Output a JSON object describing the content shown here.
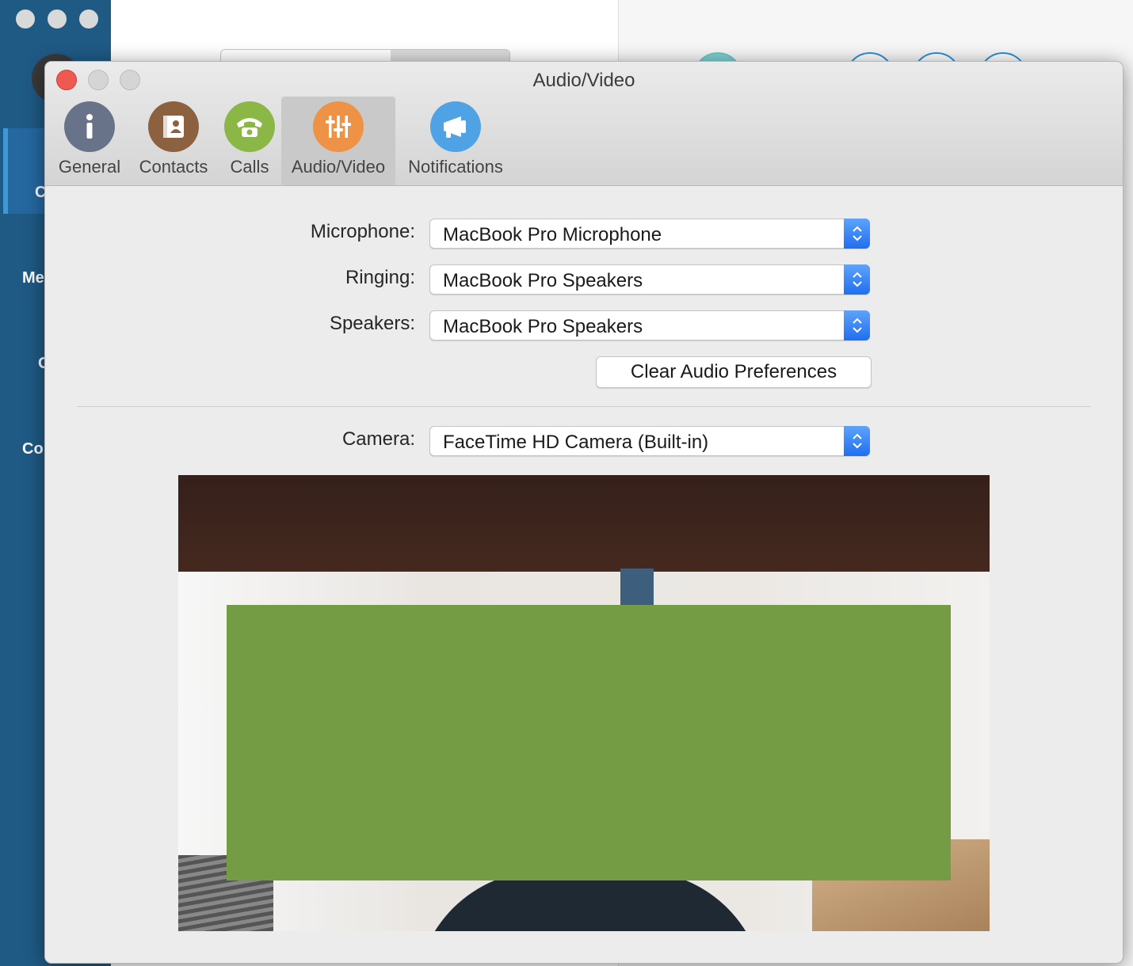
{
  "window": {
    "title": "Audio/Video"
  },
  "tabs": [
    {
      "label": "General",
      "icon": "info-icon",
      "color": "#68738a"
    },
    {
      "label": "Contacts",
      "icon": "address-book-icon",
      "color": "#8b6140"
    },
    {
      "label": "Calls",
      "icon": "phone-icon",
      "color": "#8ab746"
    },
    {
      "label": "Audio/Video",
      "icon": "sliders-icon",
      "color": "#ee9346",
      "selected": true
    },
    {
      "label": "Notifications",
      "icon": "megaphone-icon",
      "color": "#4fa3e5"
    }
  ],
  "audio": {
    "microphone_label": "Microphone:",
    "microphone_value": "MacBook Pro Microphone",
    "ringing_label": "Ringing:",
    "ringing_value": "MacBook Pro Speakers",
    "speakers_label": "Speakers:",
    "speakers_value": "MacBook Pro Speakers",
    "clear_button": "Clear Audio Preferences"
  },
  "video": {
    "camera_label": "Camera:",
    "camera_value": "FaceTime HD Camera (Built-in)"
  },
  "background_app": {
    "sidebar_color": "#1f5a85",
    "nav_fragments": [
      "C",
      "Me",
      "C",
      "Co"
    ]
  },
  "colors": {
    "stepper_blue": "#2f7ff3",
    "redaction_green": "#739c45"
  }
}
